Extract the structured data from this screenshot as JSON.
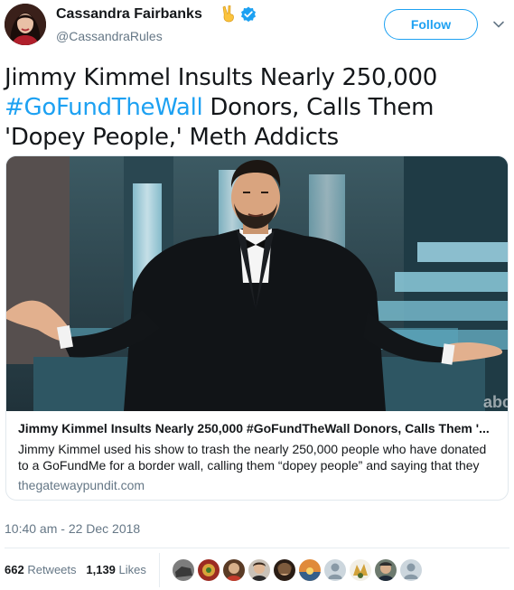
{
  "author": {
    "name": "Cassandra Fairbanks",
    "handle": "@CassandraRules",
    "emoji_icon": "victory-hand-icon",
    "verified_icon": "verified-badge-icon"
  },
  "follow_label": "Follow",
  "tweet": {
    "text_before": "Jimmy Kimmel Insults Nearly 250,000 ",
    "hashtag": "#GoFundTheWall",
    "text_after": " Donors, Calls Them 'Dopey People,' Meth Addicts"
  },
  "card": {
    "title": "Jimmy Kimmel Insults Nearly 250,000 #GoFundTheWall Donors, Calls Them '...",
    "description": "Jimmy Kimmel used his show to trash the nearly 250,000 people who have donated to a GoFundMe for a border wall, calling them “dopey people” and saying that they",
    "domain": "thegatewaypundit.com",
    "watermark": "abc"
  },
  "timestamp": "10:40 am - 22 Dec 2018",
  "stats": {
    "retweets_count": "662",
    "retweets_label": "Retweets",
    "likes_count": "1,139",
    "likes_label": "Likes"
  },
  "colors": {
    "accent": "#1da1f2",
    "secondary_text": "#657786",
    "border": "#e1e8ed"
  }
}
